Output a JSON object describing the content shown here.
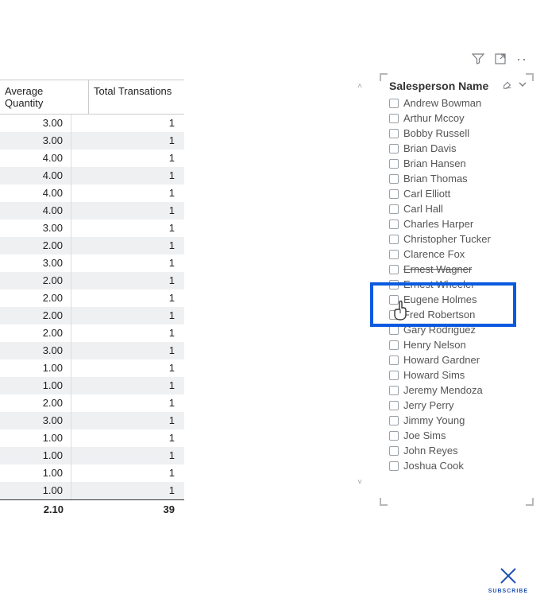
{
  "table": {
    "headers": {
      "avg_qty": "Average Quantity",
      "total_trx": "Total Transations"
    },
    "rows": [
      {
        "avg": "3.00",
        "trx": "1"
      },
      {
        "avg": "3.00",
        "trx": "1"
      },
      {
        "avg": "4.00",
        "trx": "1"
      },
      {
        "avg": "4.00",
        "trx": "1"
      },
      {
        "avg": "4.00",
        "trx": "1"
      },
      {
        "avg": "4.00",
        "trx": "1"
      },
      {
        "avg": "3.00",
        "trx": "1"
      },
      {
        "avg": "2.00",
        "trx": "1"
      },
      {
        "avg": "3.00",
        "trx": "1"
      },
      {
        "avg": "2.00",
        "trx": "1"
      },
      {
        "avg": "2.00",
        "trx": "1"
      },
      {
        "avg": "2.00",
        "trx": "1"
      },
      {
        "avg": "2.00",
        "trx": "1"
      },
      {
        "avg": "3.00",
        "trx": "1"
      },
      {
        "avg": "1.00",
        "trx": "1"
      },
      {
        "avg": "1.00",
        "trx": "1"
      },
      {
        "avg": "2.00",
        "trx": "1"
      },
      {
        "avg": "3.00",
        "trx": "1"
      },
      {
        "avg": "1.00",
        "trx": "1"
      },
      {
        "avg": "1.00",
        "trx": "1"
      },
      {
        "avg": "1.00",
        "trx": "1"
      },
      {
        "avg": "1.00",
        "trx": "1"
      }
    ],
    "totals": {
      "avg": "2.10",
      "trx": "39"
    }
  },
  "slicer": {
    "title": "Salesperson Name",
    "items": [
      "Andrew Bowman",
      "Arthur Mccoy",
      "Bobby Russell",
      "Brian Davis",
      "Brian Hansen",
      "Brian Thomas",
      "Carl Elliott",
      "Carl Hall",
      "Charles Harper",
      "Christopher Tucker",
      "Clarence Fox",
      "Ernest Wagner",
      "Ernest Wheeler",
      "Eugene Holmes",
      "Fred Robertson",
      "Gary Rodriguez",
      "Henry Nelson",
      "Howard Gardner",
      "Howard Sims",
      "Jeremy Mendoza",
      "Jerry Perry",
      "Jimmy Young",
      "Joe Sims",
      "John Reyes",
      "Joshua Cook"
    ]
  },
  "subscribe": {
    "label": "SUBSCRIBE"
  },
  "icons": {
    "filter": "filter-icon",
    "focus": "focus-mode-icon",
    "more": "more-options-icon",
    "eraser": "clear-selections-icon",
    "chevron": "chevron-down-icon"
  }
}
